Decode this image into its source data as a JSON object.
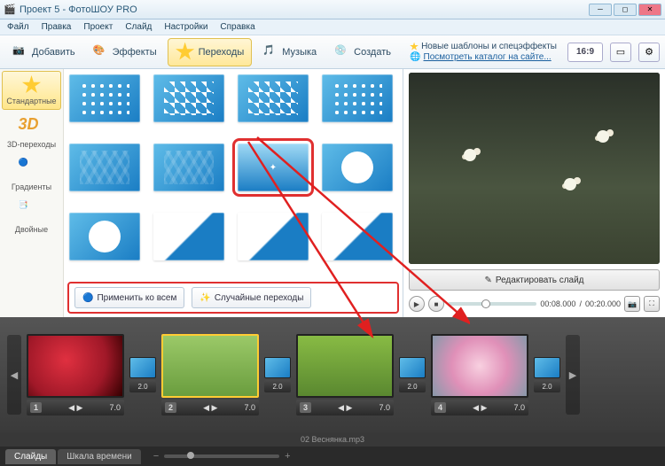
{
  "window": {
    "title": "Проект 5 - ФотоШОУ PRO"
  },
  "menu": [
    "Файл",
    "Правка",
    "Проект",
    "Слайд",
    "Настройки",
    "Справка"
  ],
  "toolbar": {
    "add": "Добавить",
    "effects": "Эффекты",
    "transitions": "Переходы",
    "music": "Музыка",
    "create": "Создать"
  },
  "promo": {
    "line1": "Новые шаблоны и спецэффекты",
    "line2": "Посмотреть каталог на сайте..."
  },
  "aspect": "16:9",
  "sidebar": {
    "standard": "Стандартные",
    "threed": "3D-переходы",
    "gradients": "Градиенты",
    "double": "Двойные"
  },
  "actions": {
    "apply_all": "Применить ко всем",
    "random": "Случайные переходы"
  },
  "preview": {
    "edit": "Редактировать слайд",
    "time_current": "00:08.000",
    "time_total": "00:20.000"
  },
  "timeline": {
    "clips": [
      {
        "n": "1",
        "dur": "7.0"
      },
      {
        "n": "2",
        "dur": "7.0"
      },
      {
        "n": "3",
        "dur": "7.0"
      },
      {
        "n": "4",
        "dur": "7.0"
      }
    ],
    "trans_dur": "2.0",
    "audio": "02 Веснянка.mp3"
  },
  "tabs": {
    "slides": "Слайды",
    "timescale": "Шкала времени"
  }
}
